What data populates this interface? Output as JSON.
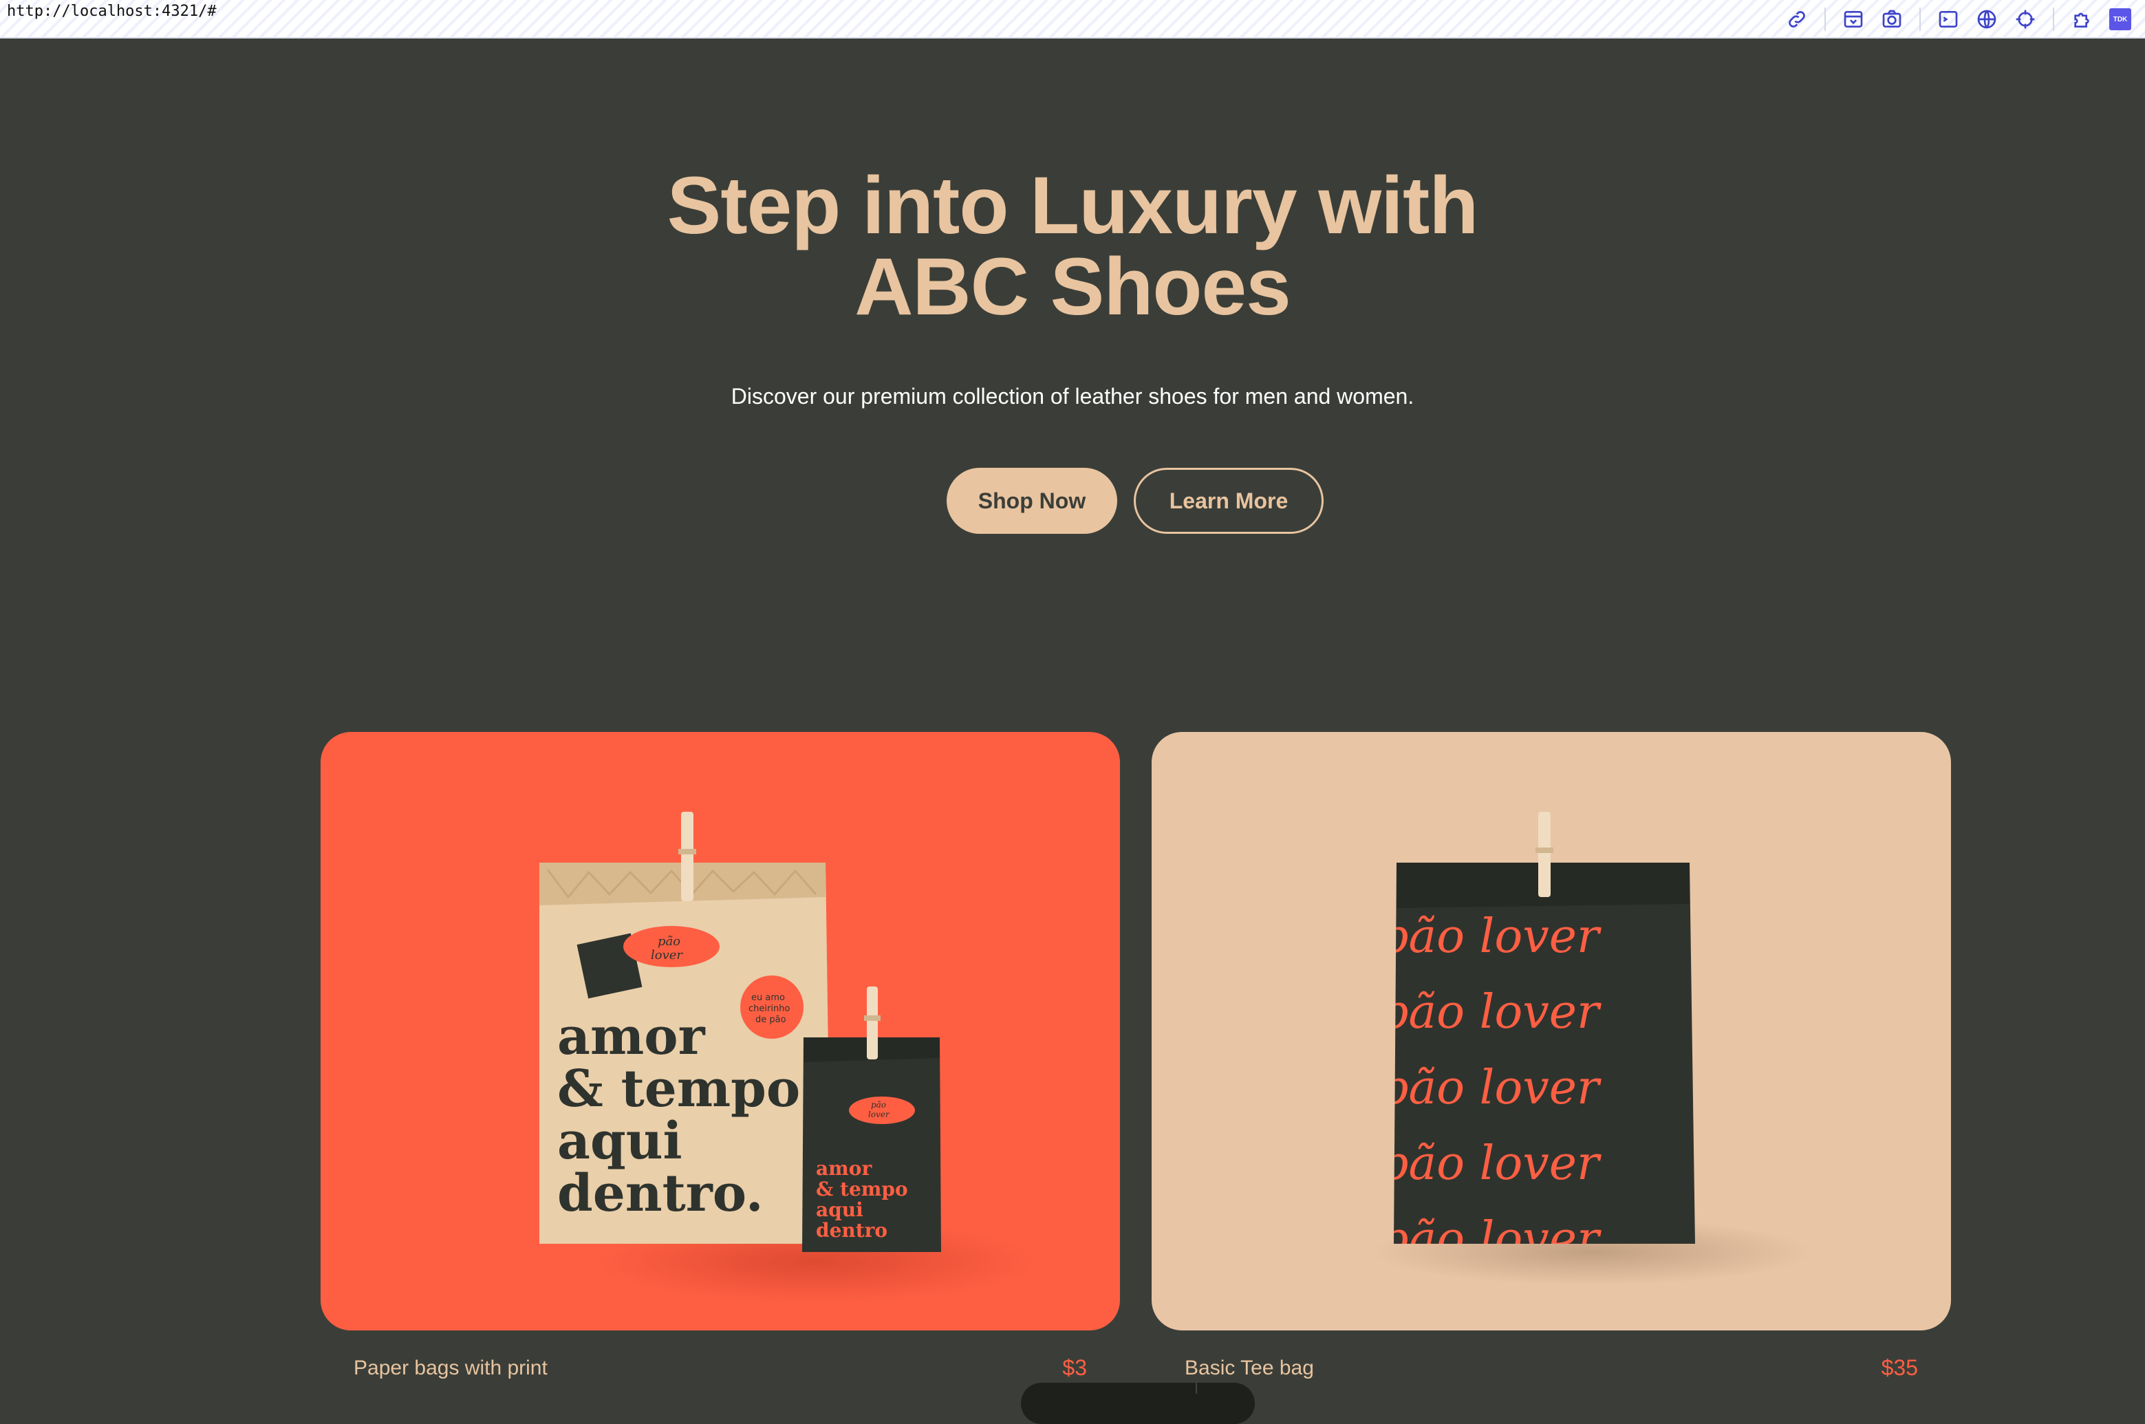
{
  "browser": {
    "url": "http://localhost:4321/#",
    "toolbar_icons": [
      "link-icon",
      "inspect-icon",
      "camera-icon",
      "terminal-icon",
      "globe-icon",
      "crosshair-icon",
      "extension-icon",
      "tdk-icon"
    ],
    "tdk_label": "TDK"
  },
  "hero": {
    "title_line1": "Step into Luxury with",
    "title_line2": "ABC Shoes",
    "subtitle": "Discover our premium collection of leather shoes for men and women.",
    "primary_button": "Shop Now",
    "secondary_button": "Learn More"
  },
  "products": [
    {
      "name": "Paper bags with print",
      "price": "$3",
      "bg_color": "#fe5f43",
      "bag_text_large": [
        "amor",
        "& tempo",
        "aqui",
        "dentro."
      ],
      "bag_text_small": [
        "amor",
        "& tempo",
        "aqui",
        "dentro"
      ],
      "sticker_text": [
        "eu amo",
        "cheirinho",
        "de pão"
      ],
      "logo_text": [
        "pão",
        "lover"
      ]
    },
    {
      "name": "Basic Tee bag",
      "price": "$35",
      "bg_color": "#e8c5a5",
      "pattern_text": "pão lover"
    }
  ],
  "colors": {
    "background": "#3b3e38",
    "accent": "#e8c4a0",
    "price": "#fe5f43",
    "dark_bag": "#2f332e"
  }
}
